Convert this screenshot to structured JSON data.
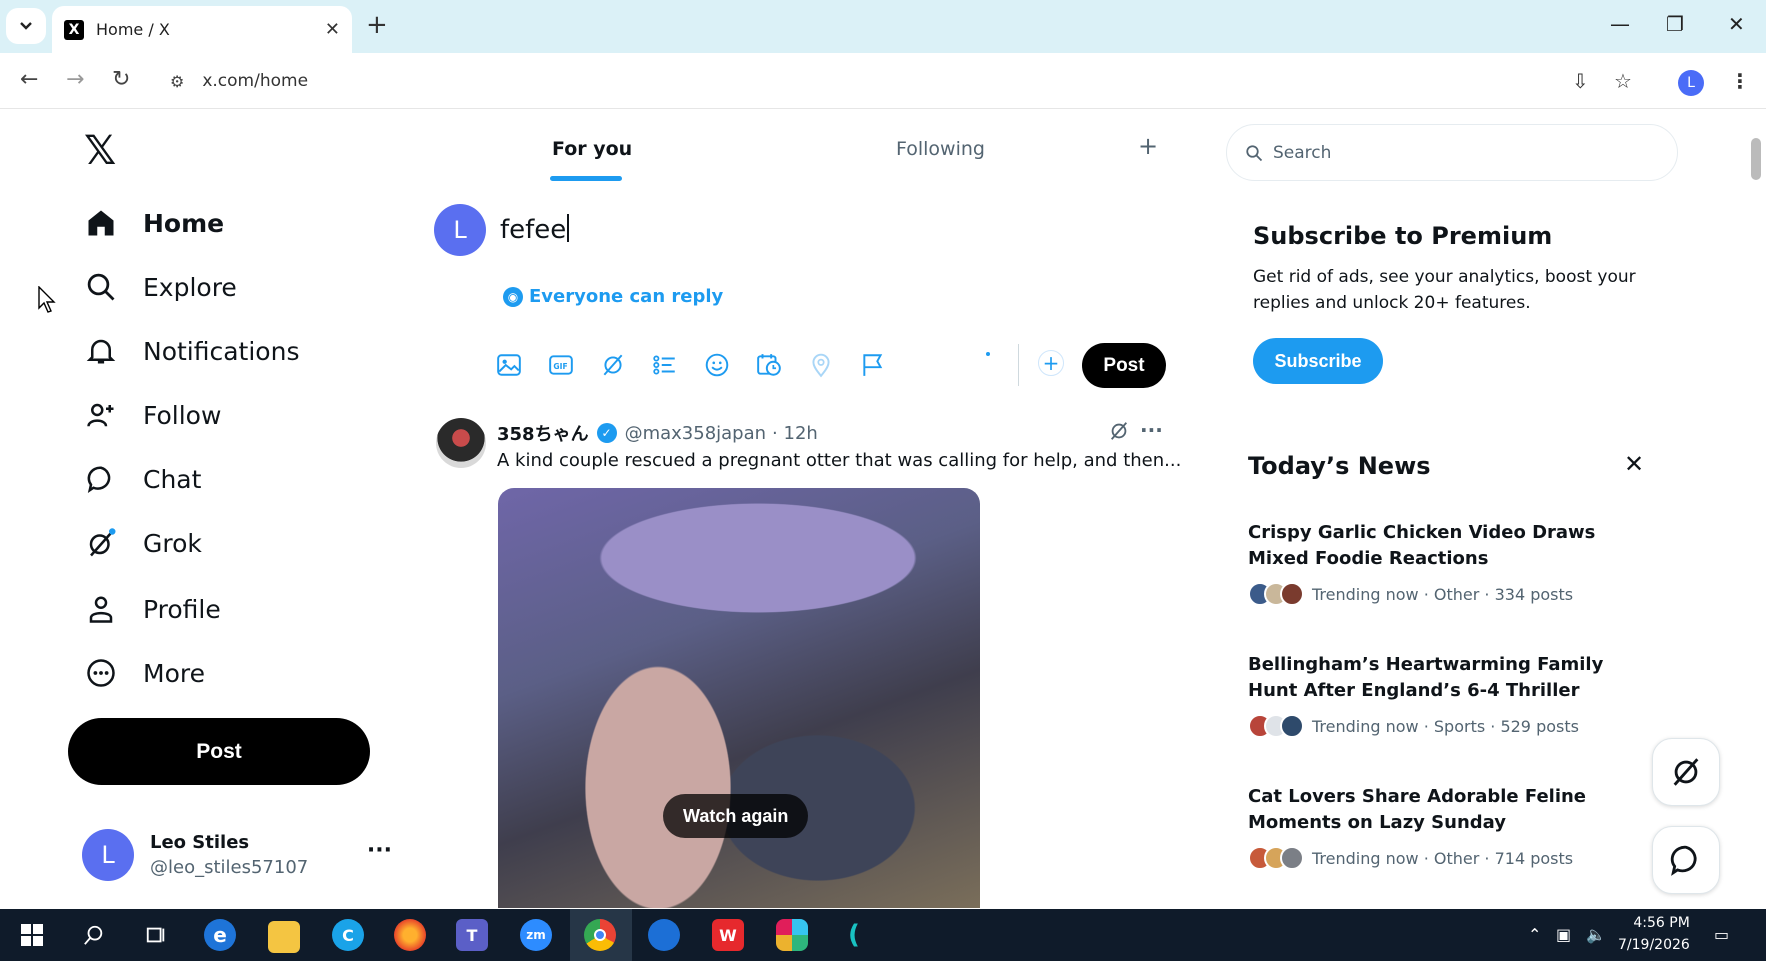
{
  "browser": {
    "tab_title": "Home / X",
    "tab_favicon": "X",
    "url": "x.com/home",
    "profile_initial": "L"
  },
  "sidebar": {
    "logo": "𝕏",
    "items": [
      {
        "label": "Home",
        "icon": "home-icon",
        "active": true
      },
      {
        "label": "Explore",
        "icon": "search-icon"
      },
      {
        "label": "Notifications",
        "icon": "bell-icon"
      },
      {
        "label": "Follow",
        "icon": "person-add-icon"
      },
      {
        "label": "Chat",
        "icon": "chat-bubble-icon"
      },
      {
        "label": "Grok",
        "icon": "grok-icon"
      },
      {
        "label": "Profile",
        "icon": "person-icon"
      },
      {
        "label": "More",
        "icon": "more-circle-icon"
      }
    ],
    "post_label": "Post",
    "account": {
      "initial": "L",
      "name": "Leo Stiles",
      "handle": "@leo_stiles57107",
      "more": "···"
    }
  },
  "feed": {
    "tabs": [
      {
        "label": "For you",
        "active": true
      },
      {
        "label": "Following"
      }
    ],
    "tab_add": "+",
    "composer": {
      "avatar_initial": "L",
      "text": "fefee",
      "reply_setting": "Everyone can reply",
      "post_label": "Post"
    },
    "tweet": {
      "name": "358ちゃん",
      "handle": "@max358japan",
      "time": "· 12h",
      "text": "A kind couple rescued a pregnant otter that was calling for help, and then...",
      "media_button": "Watch again"
    }
  },
  "right": {
    "search_placeholder": "Search",
    "premium": {
      "title": "Subscribe to Premium",
      "text": "Get rid of ads, see your analytics, boost your replies and unlock 20+ features.",
      "button": "Subscribe"
    },
    "news": {
      "title": "Today’s News",
      "items": [
        {
          "headline": "Crispy Garlic Chicken Video Draws Mixed Foodie Reactions",
          "meta": "Trending now · Other · 334 posts"
        },
        {
          "headline": "Bellingham’s Heartwarming Family Hunt After England’s 6-4 Thriller",
          "meta": "Trending now · Sports · 529 posts"
        },
        {
          "headline": "Cat Lovers Share Adorable Feline Moments on Lazy Sunday",
          "meta": "Trending now · Other · 714 posts"
        }
      ]
    }
  },
  "taskbar": {
    "time": "4:56 PM",
    "date": "7/19/2026"
  },
  "colors": {
    "accent": "#1d9bf0",
    "titlebar": "#dbf1f7",
    "taskbar": "#0f1b2a"
  }
}
